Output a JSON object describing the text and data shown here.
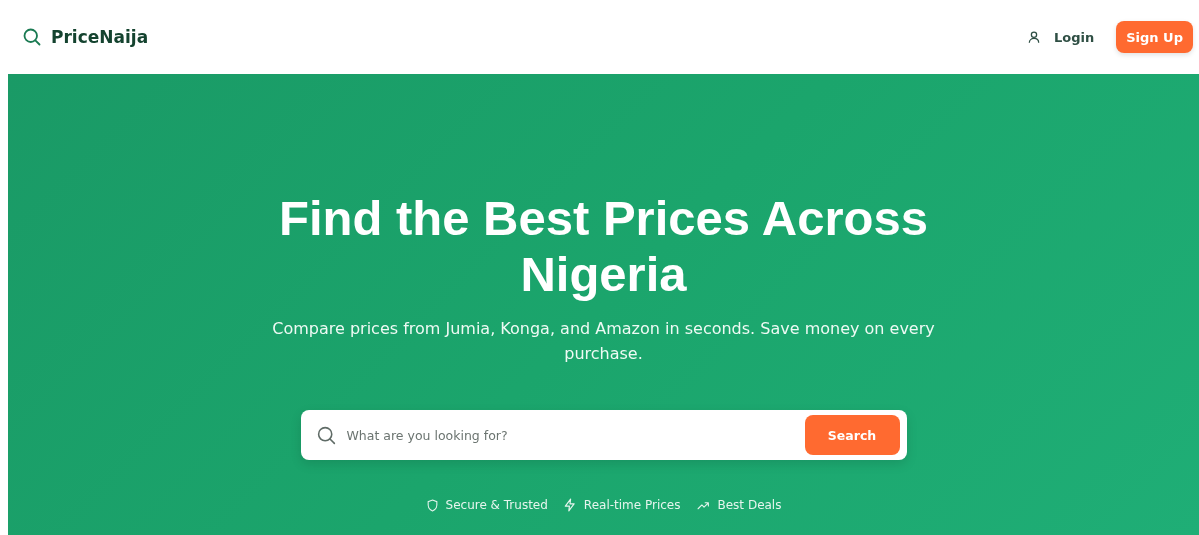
{
  "header": {
    "brand": "PriceNaija",
    "login": "Login",
    "signup": "Sign Up"
  },
  "hero": {
    "title": "Find the Best Prices Across Nigeria",
    "subtitle": "Compare prices from Jumia, Konga, and Amazon in seconds. Save money on every purchase.",
    "search": {
      "placeholder": "What are you looking for?",
      "button": "Search"
    },
    "features": [
      {
        "kind": "shield",
        "label": "Secure & Trusted"
      },
      {
        "kind": "bolt",
        "label": "Real-time Prices"
      },
      {
        "kind": "trend",
        "label": "Best Deals"
      }
    ]
  }
}
